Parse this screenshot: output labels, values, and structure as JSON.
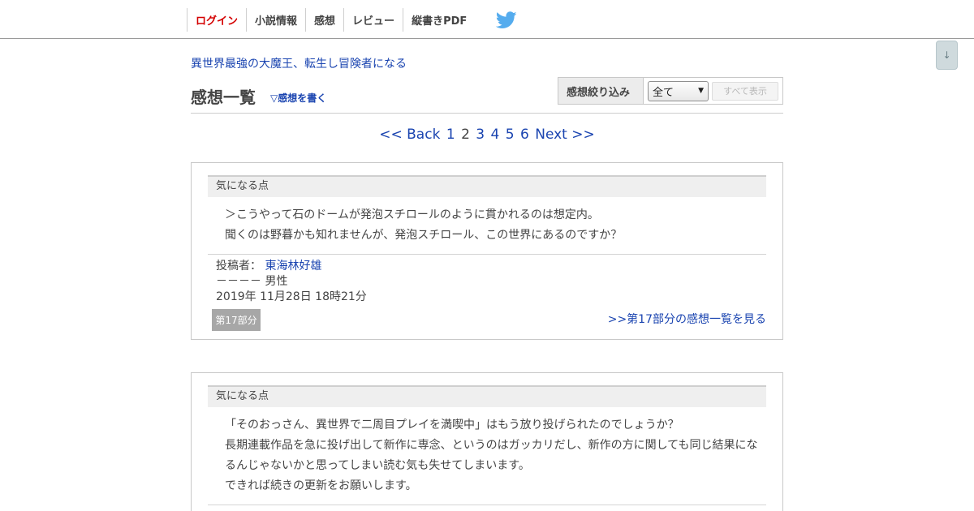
{
  "nav": {
    "login": "ログイン",
    "novel_info": "小説情報",
    "impressions": "感想",
    "review": "レビュー",
    "vertical_pdf": "縦書きPDF",
    "twitter_icon": "twitter-bird"
  },
  "scroll_down_label": "↓",
  "novel_title": "異世界最強の大魔王、転生し冒険者になる",
  "page_title": "感想一覧",
  "write_link": "▽感想を書く",
  "filter": {
    "label": "感想絞り込み",
    "selected": "全て",
    "show_all": "すべて表示"
  },
  "pager": {
    "back": "<< Back",
    "pages": [
      "1",
      "2",
      "3",
      "4",
      "5",
      "6"
    ],
    "current": "2",
    "next": "Next >>"
  },
  "comments": [
    {
      "category": "気になる点",
      "lines": [
        "＞こうやって石のドームが発泡スチロールのように貫かれるのは想定内。",
        "聞くのは野暮かも知れませんが、発泡スチロール、この世界にあるのですか？"
      ],
      "author_prefix": "投稿者：",
      "author": "東海林好雄",
      "gender": "－－－－ 男性",
      "date": "2019年 11月28日 18時21分",
      "chapter": "第17部分",
      "chapter_link": ">>第17部分の感想一覧を見る"
    },
    {
      "category": "気になる点",
      "lines": [
        "「そのおっさん、異世界で二周目プレイを満喫中」はもう放り投げられたのでしょうか？",
        "長期連載作品を急に投げ出して新作に専念、というのはガッカリだし、新作の方に関しても同じ結果にな",
        "るんじゃないかと思ってしまい読む気も失せてしまいます。",
        "できれば続きの更新をお願いします。"
      ]
    }
  ],
  "colors": {
    "link": "#1a44b0",
    "login": "#d40000",
    "twitter": "#55acee"
  }
}
